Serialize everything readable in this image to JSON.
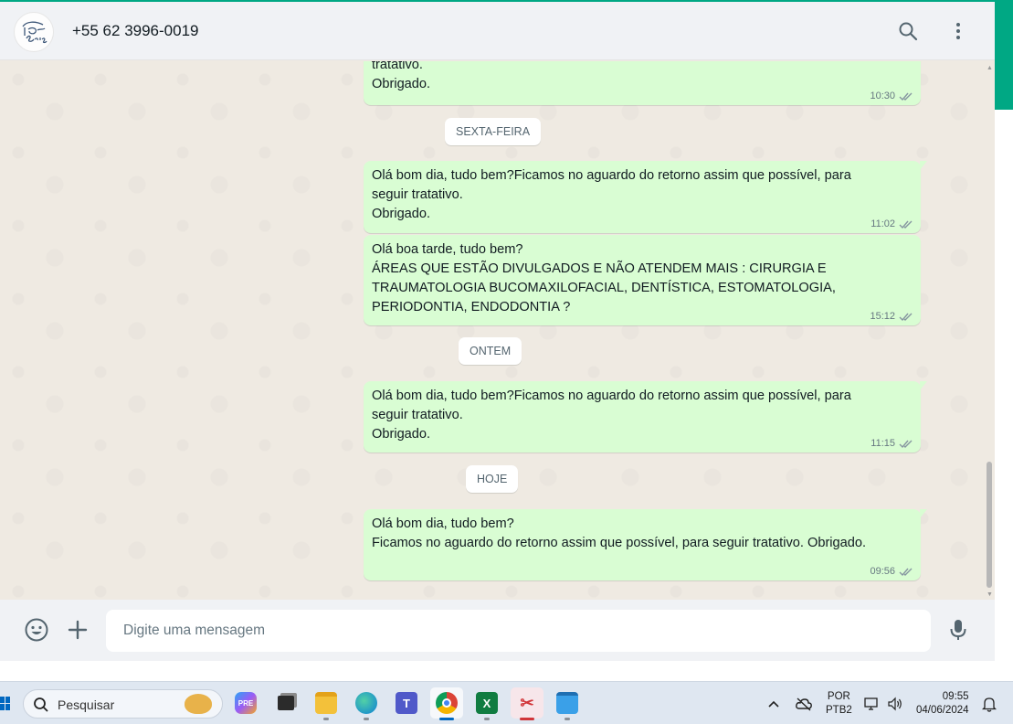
{
  "header": {
    "contact": "+55 62 3996-0019",
    "avatar_text": "Idonto Reis",
    "icons": [
      "search-icon",
      "menu-dots-icon"
    ]
  },
  "messages": [
    {
      "text": "tratativo.\nObrigado.",
      "time": "10:30",
      "status": "read"
    },
    {
      "text": "Olá bom dia, tudo bem?Ficamos no aguardo do retorno assim que possível, para seguir tratativo.\nObrigado.",
      "time": "11:02",
      "status": "read"
    },
    {
      "text": "Olá boa tarde, tudo bem?\nÁREAS QUE ESTÃO DIVULGADOS E NÃO ATENDEM MAIS : CIRURGIA E TRAUMATOLOGIA BUCOMAXILOFACIAL, DENTÍSTICA, ESTOMATOLOGIA, PERIODONTIA, ENDODONTIA ?",
      "time": "15:12",
      "status": "read"
    },
    {
      "text": "Olá bom dia, tudo bem?Ficamos no aguardo do retorno assim que possível, para seguir tratativo.\nObrigado.",
      "time": "11:15",
      "status": "read"
    },
    {
      "text": "Olá bom dia, tudo bem?\nFicamos no aguardo do retorno assim que possível, para seguir tratativo. Obrigado.",
      "time": "09:56",
      "status": "read"
    }
  ],
  "date_dividers": [
    "SEXTA-FEIRA",
    "ONTEM",
    "HOJE"
  ],
  "composer": {
    "placeholder": "Digite uma mensagem",
    "icons": [
      "emoji-icon",
      "plus-icon",
      "microphone-icon"
    ]
  },
  "taskbar": {
    "search_placeholder": "Pesquisar",
    "apps": [
      "copilot-icon",
      "task-view-icon",
      "file-explorer-icon",
      "edge-icon",
      "teams-icon",
      "chrome-icon",
      "excel-icon",
      "snipping-tool-icon",
      "notepad-icon"
    ],
    "language_line1": "POR",
    "language_line2": "PTB2",
    "time": "09:55",
    "date": "04/06/2024"
  },
  "colors": {
    "accent": "#00a884",
    "outgoing_bubble": "#d9fdd3",
    "chat_background": "#efeae2",
    "header_background": "#f0f2f5",
    "read_ticks": "#8696a0"
  }
}
